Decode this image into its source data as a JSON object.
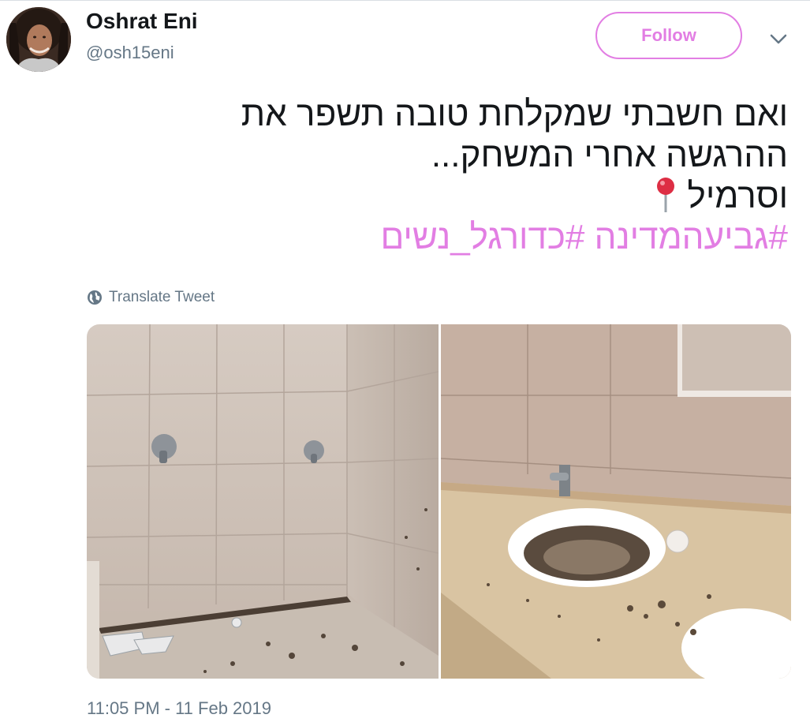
{
  "user": {
    "name": "Oshrat Eni",
    "handle": "@osh15eni",
    "avatar_icon": "profile-photo"
  },
  "actions": {
    "follow_label": "Follow",
    "menu_icon": "chevron-down-icon"
  },
  "tweet": {
    "lines": [
      "ואם חשבתי שמקלחת טובה תשפר את",
      "ההרגשה אחרי המשחק...",
      "וסרמיל"
    ],
    "pin_icon": "round-pushpin-icon",
    "hashtags": [
      "#גביעהמדינה",
      "#כדורגל_נשים"
    ],
    "translate_label": "Translate Tweet"
  },
  "media": {
    "photos": [
      {
        "subject": "dirty-shower-room"
      },
      {
        "subject": "dirty-sink-counter"
      }
    ]
  },
  "timestamp": "11:05 PM - 11 Feb 2019",
  "colors": {
    "accent": "#e27ee3",
    "secondary_text": "#657786",
    "primary_text": "#14171a"
  }
}
